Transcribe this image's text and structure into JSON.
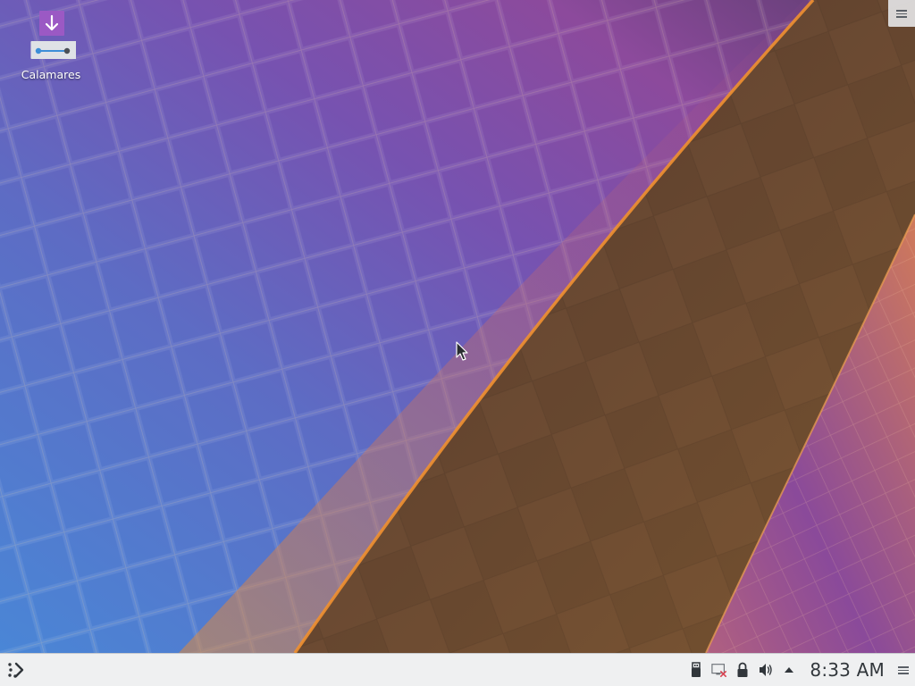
{
  "desktop": {
    "icons": [
      {
        "label": "Calamares",
        "icon": "calamares-installer-icon"
      }
    ],
    "toolbox_icon": "hamburger-menu-icon"
  },
  "panel": {
    "launcher_icon": "kde-application-launcher-icon",
    "tray": {
      "icons": [
        "usb-device-icon",
        "network-disconnected-icon",
        "lock-screen-icon",
        "volume-icon",
        "expand-tray-arrow-icon"
      ],
      "clock": "8:33 AM",
      "options_icon": "panel-options-icon"
    }
  },
  "colors": {
    "panel_bg": "#eff0f1",
    "accent_purple": "#9b4fc4",
    "wallpaper_orange": "#f08a30",
    "wallpaper_brown": "#6e4a30"
  }
}
